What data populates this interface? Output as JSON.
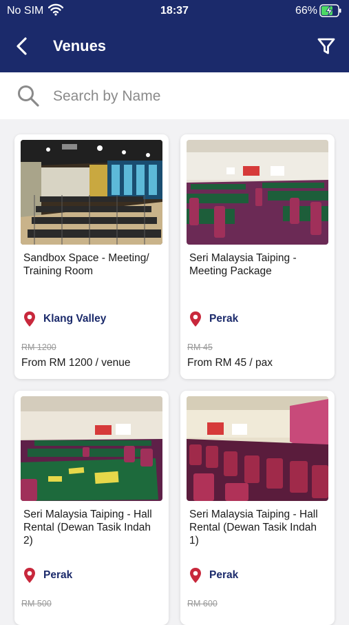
{
  "status": {
    "carrier": "No SIM",
    "time": "18:37",
    "battery": "66%"
  },
  "nav": {
    "title": "Venues"
  },
  "search": {
    "placeholder": "Search by Name"
  },
  "venues": [
    {
      "name": "Sandbox Space - Meeting/ Training Room",
      "location": "Klang Valley",
      "old_price": "RM 1200",
      "price": "From RM 1200 / venue"
    },
    {
      "name": "Seri Malaysia Taiping - Meeting Package",
      "location": "Perak",
      "old_price": "RM 45",
      "price": "From RM 45 / pax"
    },
    {
      "name": "Seri Malaysia Taiping - Hall Rental (Dewan Tasik Indah 2)",
      "location": "Perak",
      "old_price": "RM 500",
      "price": ""
    },
    {
      "name": "Seri Malaysia Taiping - Hall Rental (Dewan Tasik Indah 1)",
      "location": "Perak",
      "old_price": "RM 600",
      "price": ""
    }
  ],
  "colors": {
    "header_bg": "#1b2a6b",
    "accent": "#1b2a6b",
    "pin": "#c8283c",
    "page_bg": "#f2f2f4"
  },
  "icons": {
    "back": "chevron-left-icon",
    "filter": "filter-icon",
    "search": "search-icon",
    "location": "map-pin-icon"
  }
}
